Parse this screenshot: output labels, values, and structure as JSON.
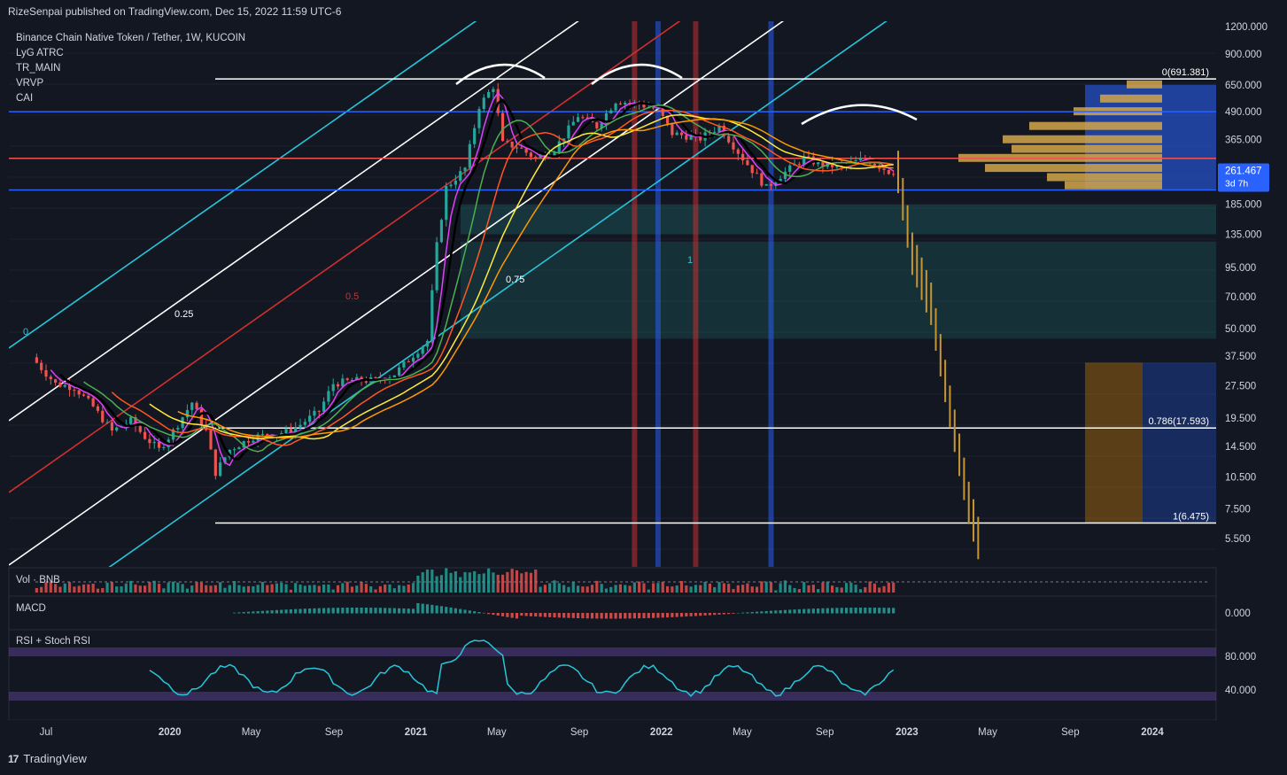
{
  "header": {
    "published": "RizeSenpai published on TradingView.com, Dec 15, 2022 11:59 UTC-6"
  },
  "footer": {
    "brand": "TradingView",
    "logo_icon": "tradingview-logo-icon"
  },
  "legend": {
    "symbol": "Binance Chain Native Token / Tether, 1W, KUCOIN",
    "indicators": [
      "LyG ATRC",
      "TR_MAIN",
      "VRVP",
      "CAI"
    ]
  },
  "price_badge": {
    "price": "261.467",
    "countdown": "3d 7h",
    "color": "#2962ff"
  },
  "panes": {
    "volume": "Vol · BNB",
    "macd": "MACD",
    "rsi": "RSI + Stoch RSI",
    "macd_zero": "0.000"
  },
  "fib_labels": {
    "top": "0(691.381)",
    "mid": "0.786(17.593)",
    "bottom": "1(6.475)"
  },
  "channel_labels": [
    "0",
    "0.25",
    "0.5",
    "0.75",
    "1"
  ],
  "colors": {
    "bg": "#131722",
    "cyan": "#26c6da",
    "red": "#d32f2f",
    "blue": "#2962ff",
    "white": "#ffffff",
    "bull": "#26a69a",
    "bear": "#ef5350"
  },
  "chart_data": [
    {
      "type": "candlestick",
      "title": "Binance Chain Native Token / Tether, 1W, KUCOIN",
      "y_scale": "log",
      "y_ticks": [
        "1200.000",
        "900.000",
        "650.000",
        "490.000",
        "365.000",
        "261.467",
        "185.000",
        "135.000",
        "95.000",
        "70.000",
        "50.000",
        "37.500",
        "27.500",
        "19.500",
        "14.500",
        "10.500",
        "7.500",
        "5.500"
      ],
      "y_tick_values": [
        1200,
        900,
        650,
        490,
        365,
        261.467,
        185,
        135,
        95,
        70,
        50,
        37.5,
        27.5,
        19.5,
        14.5,
        10.5,
        7.5,
        5.5
      ],
      "x_ticks": [
        "Jul",
        "2020",
        "May",
        "Sep",
        "2021",
        "May",
        "Sep",
        "2022",
        "May",
        "Sep",
        "2023",
        "May",
        "Sep",
        "2024"
      ],
      "close_path": [
        [
          "2019-06-17",
          37
        ],
        [
          "2019-07-01",
          33
        ],
        [
          "2019-07-22",
          28
        ],
        [
          "2019-08-19",
          27
        ],
        [
          "2019-09-16",
          22
        ],
        [
          "2019-10-14",
          17
        ],
        [
          "2019-11-11",
          19
        ],
        [
          "2019-12-02",
          16
        ],
        [
          "2019-12-23",
          14
        ],
        [
          "2020-01-13",
          17
        ],
        [
          "2020-02-10",
          23
        ],
        [
          "2020-03-02",
          17
        ],
        [
          "2020-03-16",
          11
        ],
        [
          "2020-04-06",
          14
        ],
        [
          "2020-05-11",
          16
        ],
        [
          "2020-07-06",
          17
        ],
        [
          "2020-08-17",
          21
        ],
        [
          "2020-09-07",
          28
        ],
        [
          "2020-10-05",
          29
        ],
        [
          "2020-11-09",
          29
        ],
        [
          "2020-12-07",
          31
        ],
        [
          "2021-01-04",
          38
        ],
        [
          "2021-01-25",
          44
        ],
        [
          "2021-02-08",
          120
        ],
        [
          "2021-02-22",
          220
        ],
        [
          "2021-03-22",
          270
        ],
        [
          "2021-04-12",
          520
        ],
        [
          "2021-05-03",
          640
        ],
        [
          "2021-05-17",
          350
        ],
        [
          "2021-06-07",
          340
        ],
        [
          "2021-07-05",
          300
        ],
        [
          "2021-08-02",
          330
        ],
        [
          "2021-09-06",
          470
        ],
        [
          "2021-10-04",
          420
        ],
        [
          "2021-11-01",
          550
        ],
        [
          "2021-12-06",
          530
        ],
        [
          "2022-01-03",
          500
        ],
        [
          "2022-01-24",
          390
        ],
        [
          "2022-03-07",
          370
        ],
        [
          "2022-04-04",
          420
        ],
        [
          "2022-05-09",
          300
        ],
        [
          "2022-06-13",
          220
        ],
        [
          "2022-07-04",
          250
        ],
        [
          "2022-08-08",
          300
        ],
        [
          "2022-09-05",
          280
        ],
        [
          "2022-10-03",
          275
        ],
        [
          "2022-11-07",
          300
        ],
        [
          "2022-12-12",
          261.467
        ]
      ],
      "horizontal_levels": [
        {
          "label": "0(691.381)",
          "value": 691.381,
          "color": "#ffffff"
        },
        {
          "label": "0.786(17.593)",
          "value": 17.593,
          "color": "#ffffff"
        },
        {
          "label": "1(6.475)",
          "value": 6.475,
          "color": "#ffffff"
        },
        {
          "value": 490,
          "color": "#2962ff"
        },
        {
          "value": 215,
          "color": "#2962ff"
        },
        {
          "value": 300,
          "color": "#ef5350"
        }
      ],
      "vertical_markers": [
        {
          "date": "2021-11-22",
          "color": "#d32f2f"
        },
        {
          "date": "2021-12-27",
          "color": "#2962ff"
        },
        {
          "date": "2022-02-21",
          "color": "#d32f2f"
        },
        {
          "date": "2022-06-13",
          "color": "#2962ff"
        }
      ],
      "channel": {
        "lines": [
          "0",
          "0.25",
          "0.5",
          "0.75",
          "1"
        ]
      },
      "projection": [
        [
          "2022-12-19",
          260
        ],
        [
          "2023-01-09",
          110
        ],
        [
          "2023-02-06",
          65
        ],
        [
          "2023-03-06",
          22
        ],
        [
          "2023-04-03",
          8
        ],
        [
          "2023-04-24",
          4.6
        ]
      ]
    },
    {
      "type": "bar",
      "title": "Vol · BNB"
    },
    {
      "type": "bar",
      "title": "MACD",
      "y_ticks": [
        "0.000"
      ]
    },
    {
      "type": "line",
      "title": "RSI + Stoch RSI",
      "y_ticks": [
        "80.000",
        "40.000"
      ],
      "bands": [
        [
          70,
          80
        ],
        [
          20,
          30
        ]
      ]
    }
  ]
}
